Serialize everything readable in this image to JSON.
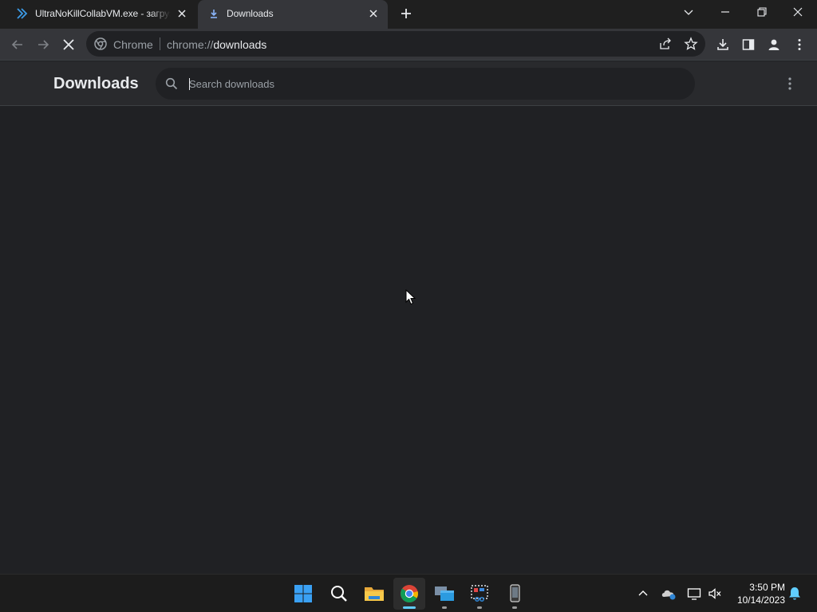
{
  "tabs": [
    {
      "title": "UltraNoKillCollabVM.exe - загрузка",
      "icon": "chevron-double-icon",
      "active": false
    },
    {
      "title": "Downloads",
      "icon": "download-icon",
      "active": true
    }
  ],
  "omnibox": {
    "site_chip": "Chrome",
    "url_scheme": "chrome://",
    "url_host": "downloads"
  },
  "page": {
    "title": "Downloads",
    "search_placeholder": "Search downloads",
    "search_value": ""
  },
  "taskbar": {
    "apps": [
      "start",
      "search",
      "file-explorer",
      "chrome",
      "remote-desktop",
      "snipping-tool",
      "phone-link"
    ],
    "active_app": "chrome"
  },
  "clock": {
    "time": "3:50 PM",
    "date": "10/14/2023"
  },
  "colors": {
    "accent": "#8ab4f8",
    "page_bg": "#202124",
    "header_bg": "#292a2d",
    "toolbar_bg": "#35363a"
  }
}
